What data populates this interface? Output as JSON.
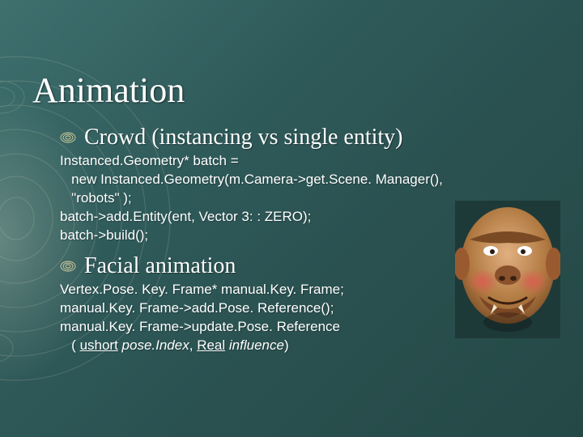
{
  "title": "Animation",
  "bullets": [
    {
      "label": "Crowd (instancing vs single entity)",
      "code": "Instanced.Geometry* batch =\n   new Instanced.Geometry(m.Camera->get.Scene. Manager(),\n   \"robots\" );\nbatch->add.Entity(ent, Vector 3: : ZERO);\nbatch->build();"
    },
    {
      "label": "Facial animation",
      "code_segments": [
        {
          "t": "Vertex.Pose. Key. Frame* manual.Key. Frame;\nmanual.Key. Frame->add.Pose. Reference();\nmanual.Key. Frame->update.Pose. Reference\n   ( "
        },
        {
          "t": "ushort",
          "u": true
        },
        {
          "t": " "
        },
        {
          "t": "pose.Index",
          "i": true
        },
        {
          "t": ", "
        },
        {
          "t": "Real",
          "u": true
        },
        {
          "t": " "
        },
        {
          "t": "influence",
          "i": true
        },
        {
          "t": ")"
        }
      ]
    }
  ],
  "icons": {
    "bullet": "contour-bullet-icon",
    "face": "ogre-face-image"
  }
}
